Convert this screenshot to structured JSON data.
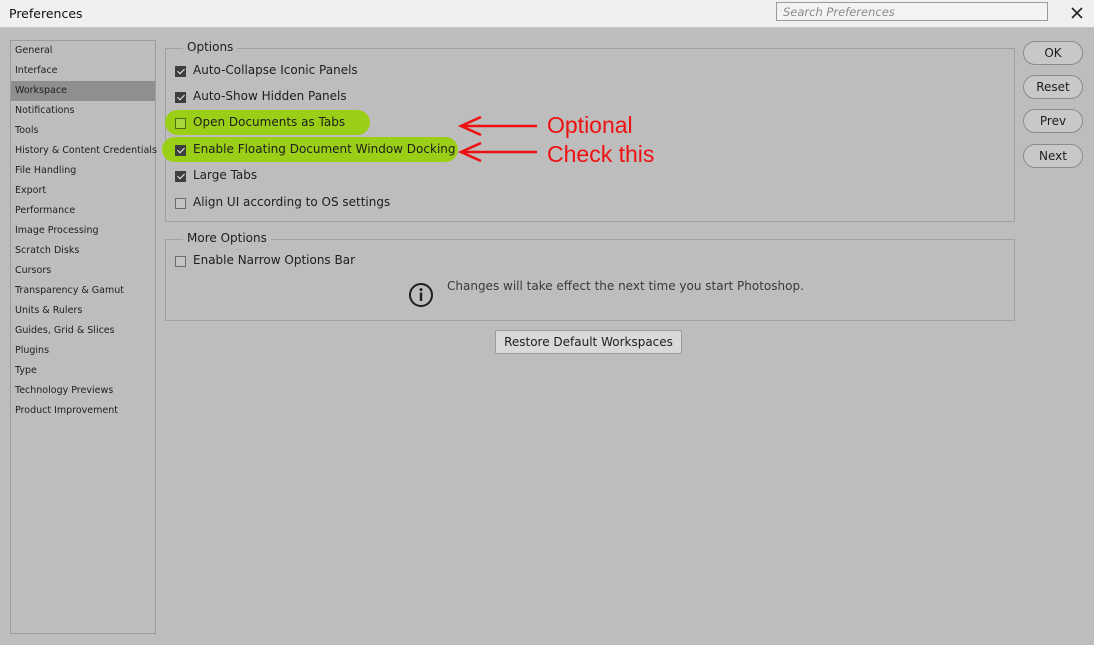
{
  "window": {
    "title": "Preferences",
    "search_placeholder": "Search Preferences"
  },
  "sidebar": {
    "items": [
      {
        "label": "General"
      },
      {
        "label": "Interface"
      },
      {
        "label": "Workspace",
        "selected": true
      },
      {
        "label": "Notifications"
      },
      {
        "label": "Tools"
      },
      {
        "label": "History & Content Credentials"
      },
      {
        "label": "File Handling"
      },
      {
        "label": "Export"
      },
      {
        "label": "Performance"
      },
      {
        "label": "Image Processing"
      },
      {
        "label": "Scratch Disks"
      },
      {
        "label": "Cursors"
      },
      {
        "label": "Transparency & Gamut"
      },
      {
        "label": "Units & Rulers"
      },
      {
        "label": "Guides, Grid & Slices"
      },
      {
        "label": "Plugins"
      },
      {
        "label": "Type"
      },
      {
        "label": "Technology Previews"
      },
      {
        "label": "Product Improvement"
      }
    ]
  },
  "options": {
    "title": "Options",
    "items": [
      {
        "label": "Auto-Collapse Iconic Panels",
        "checked": true
      },
      {
        "label": "Auto-Show Hidden Panels",
        "checked": true
      },
      {
        "label": "Open Documents as Tabs",
        "checked": false,
        "highlighted": true
      },
      {
        "label": "Enable Floating Document Window Docking",
        "checked": true,
        "highlighted": true
      },
      {
        "label": "Large Tabs",
        "checked": true
      },
      {
        "label": "Align UI according to OS settings",
        "checked": false
      }
    ]
  },
  "more_options": {
    "title": "More Options",
    "items": [
      {
        "label": "Enable Narrow Options Bar",
        "checked": false
      }
    ],
    "note": "Changes will take effect the next time you start Photoshop."
  },
  "buttons": {
    "ok": "OK",
    "reset": "Reset",
    "prev": "Prev",
    "next": "Next",
    "restore": "Restore Default Workspaces"
  },
  "annotations": {
    "optional": "Optional",
    "check_this": "Check this"
  },
  "colors": {
    "highlight": "#9bcf17",
    "annotation": "#ee1111",
    "background": "#bdbdbd"
  }
}
